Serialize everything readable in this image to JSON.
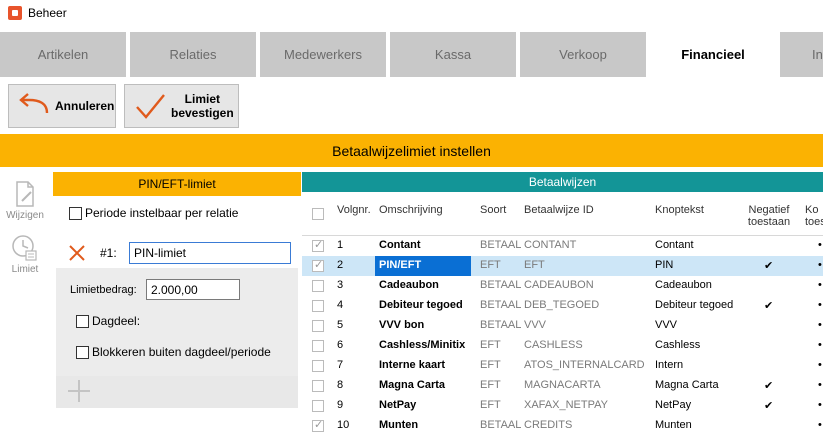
{
  "window": {
    "title": "Beheer"
  },
  "tabs": [
    {
      "label": "Artikelen",
      "active": false
    },
    {
      "label": "Relaties",
      "active": false
    },
    {
      "label": "Medewerkers",
      "active": false
    },
    {
      "label": "Kassa",
      "active": false
    },
    {
      "label": "Verkoop",
      "active": false
    },
    {
      "label": "Financieel",
      "active": true
    },
    {
      "label": "In",
      "active": false
    }
  ],
  "toolbar": {
    "cancel_label": "Annuleren",
    "confirm_label_line1": "Limiet",
    "confirm_label_line2": "bevestigen"
  },
  "banner": {
    "title": "Betaalwijzelimiet instellen"
  },
  "sidebar": {
    "edit_label": "Wijzigen",
    "limit_label": "Limiet"
  },
  "pin_panel": {
    "header": "PIN/EFT-limiet",
    "period_checkbox_label": "Periode instelbaar per relatie",
    "limit": {
      "number": "#1:",
      "name": "PIN-limiet",
      "amount_label": "Limietbedrag:",
      "amount_value": "2.000,00",
      "daypart_label": "Dagdeel:",
      "block_label": "Blokkeren buiten dagdeel/periode"
    }
  },
  "payment_methods": {
    "header": "Betaalwijzen",
    "columns": {
      "seq": "Volgnr.",
      "description": "Omschrijving",
      "type": "Soort",
      "id": "Betaalwijze ID",
      "button_text": "Knoptekst",
      "negative_line1": "Negatief",
      "negative_line2": "toestaan",
      "extra_line1": "Ko",
      "extra_line2": "toes"
    },
    "rows": [
      {
        "checked": true,
        "seq": "1",
        "description": "Contant",
        "type": "BETAAL",
        "id": "CONTANT",
        "button_text": "Contant",
        "negative": "",
        "extra": "•"
      },
      {
        "checked": true,
        "seq": "2",
        "description": "PIN/EFT",
        "type": "EFT",
        "id": "EFT",
        "button_text": "PIN",
        "negative": "✔",
        "extra": "•"
      },
      {
        "checked": false,
        "seq": "3",
        "description": "Cadeaubon",
        "type": "BETAAL",
        "id": "CADEAUBON",
        "button_text": "Cadeaubon",
        "negative": "",
        "extra": "•"
      },
      {
        "checked": false,
        "seq": "4",
        "description": "Debiteur tegoed",
        "type": "BETAAL",
        "id": "DEB_TEGOED",
        "button_text": "Debiteur tegoed",
        "negative": "✔",
        "extra": "•"
      },
      {
        "checked": false,
        "seq": "5",
        "description": "VVV bon",
        "type": "BETAAL",
        "id": "VVV",
        "button_text": "VVV",
        "negative": "",
        "extra": "•"
      },
      {
        "checked": false,
        "seq": "6",
        "description": "Cashless/Minitix",
        "type": "EFT",
        "id": "CASHLESS",
        "button_text": "Cashless",
        "negative": "",
        "extra": "•"
      },
      {
        "checked": false,
        "seq": "7",
        "description": "Interne kaart",
        "type": "EFT",
        "id": "ATOS_INTERNALCARD",
        "button_text": "Intern",
        "negative": "",
        "extra": "•"
      },
      {
        "checked": false,
        "seq": "8",
        "description": "Magna Carta",
        "type": "EFT",
        "id": "MAGNACARTA",
        "button_text": "Magna Carta",
        "negative": "✔",
        "extra": "•"
      },
      {
        "checked": false,
        "seq": "9",
        "description": "NetPay",
        "type": "EFT",
        "id": "XAFAX_NETPAY",
        "button_text": "NetPay",
        "negative": "✔",
        "extra": "•"
      },
      {
        "checked": true,
        "seq": "10",
        "description": "Munten",
        "type": "BETAAL",
        "id": "CREDITS",
        "button_text": "Munten",
        "negative": "",
        "extra": "•"
      }
    ]
  },
  "colors": {
    "accent_orange": "#fbb202",
    "teal_header": "#139597",
    "selection_blue": "#0a6fd4",
    "selection_row": "#cde6f7",
    "tab_inactive": "#c8c8c8"
  }
}
